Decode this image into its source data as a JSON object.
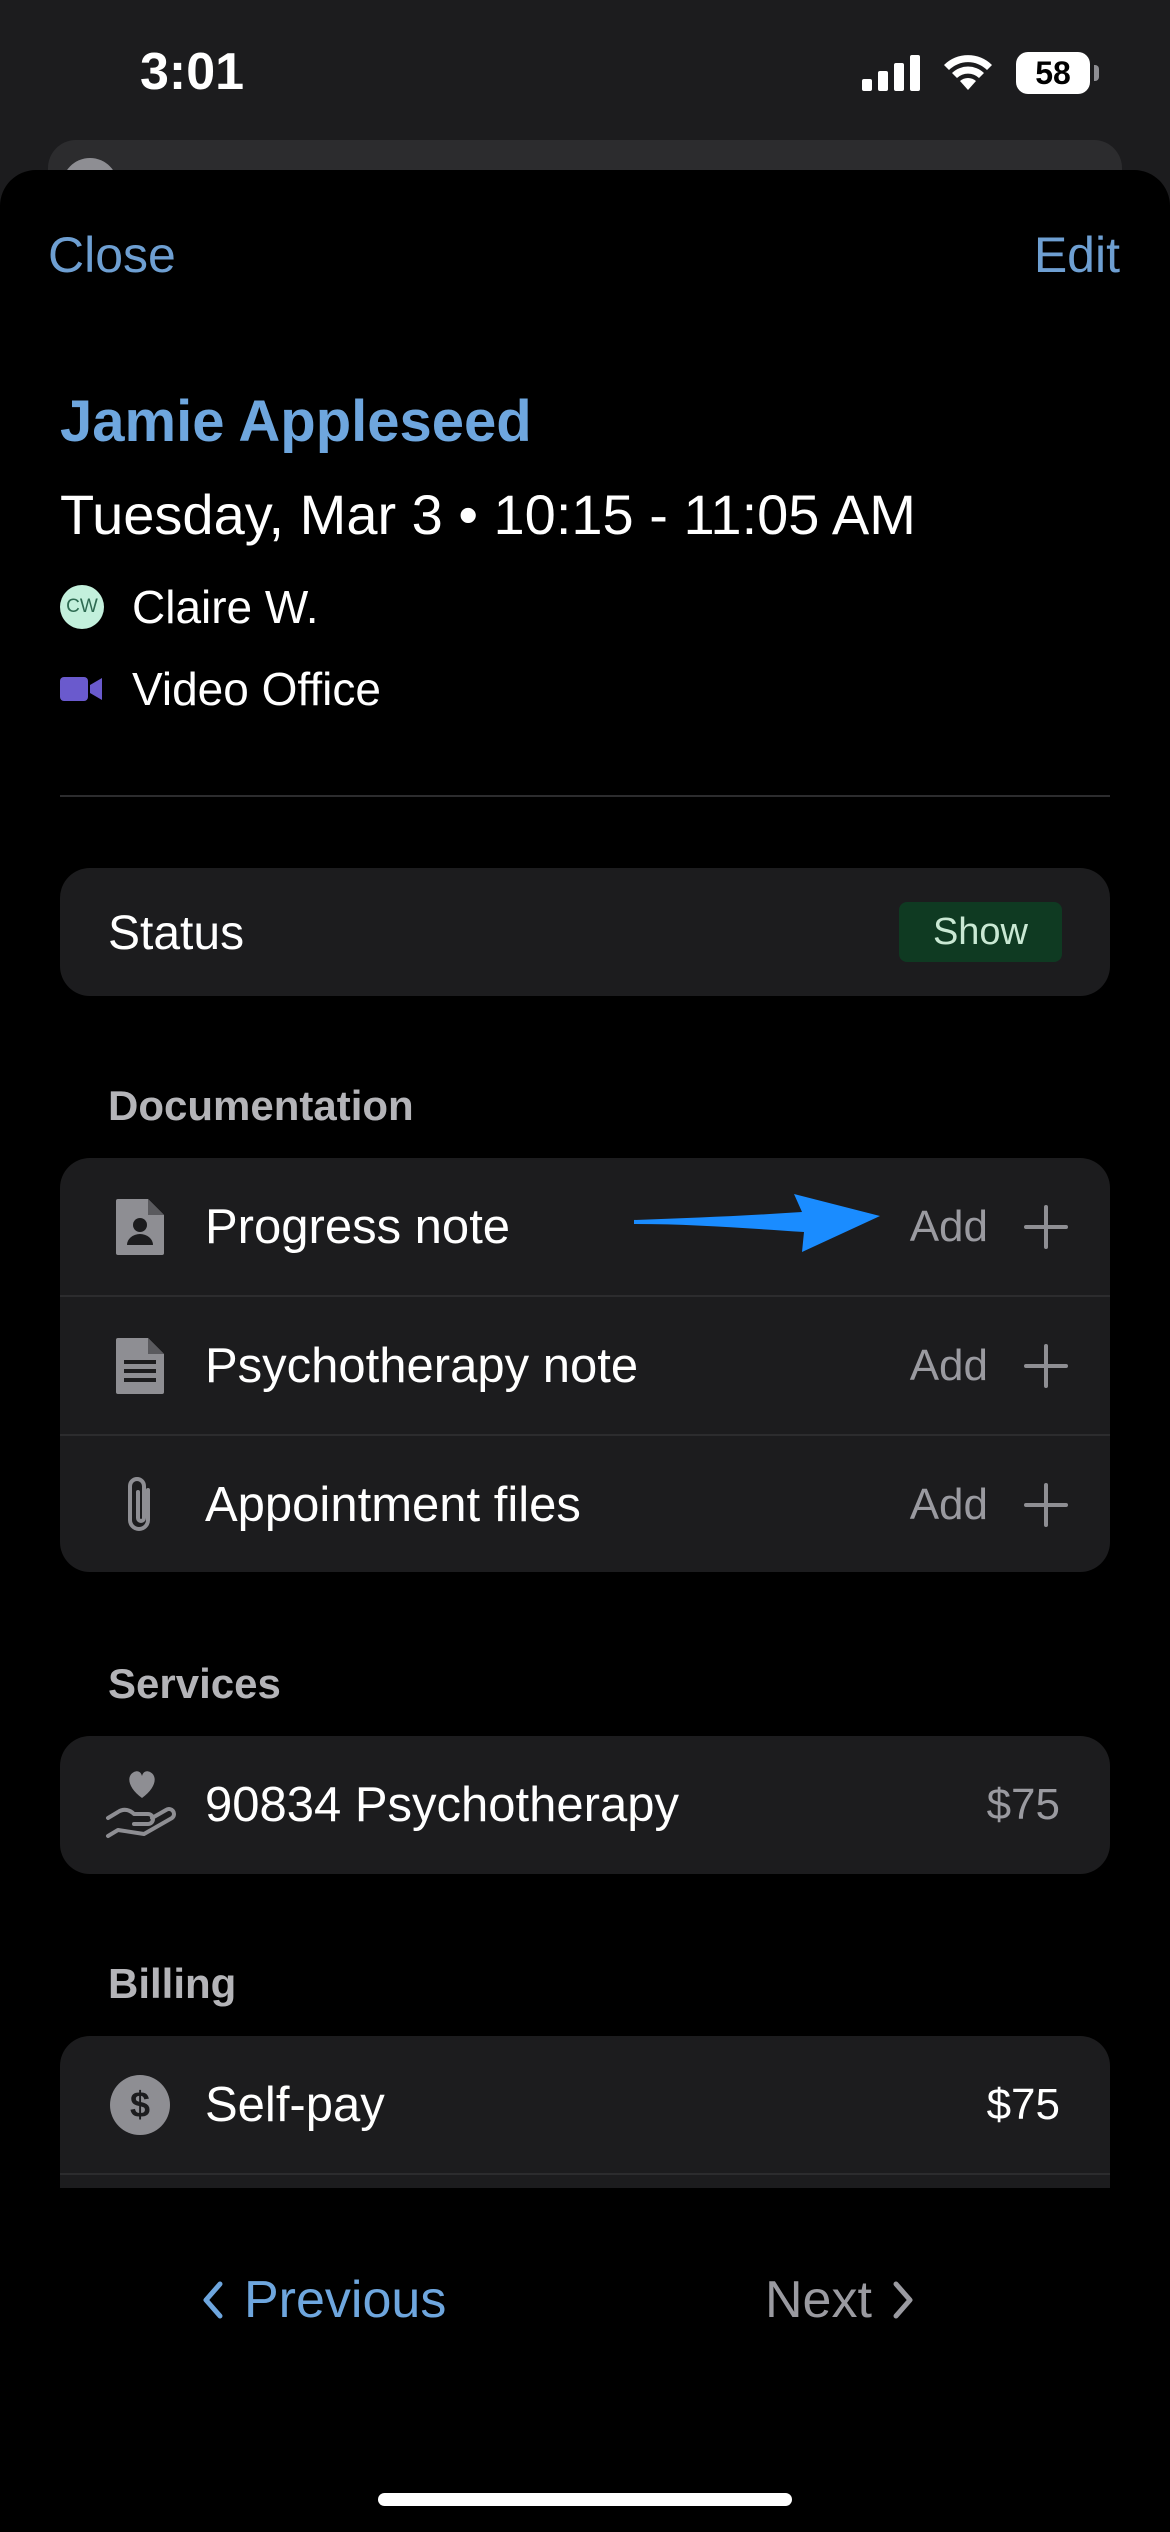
{
  "status_bar": {
    "time": "3:01",
    "battery": "58"
  },
  "header": {
    "close_label": "Close",
    "edit_label": "Edit"
  },
  "appointment": {
    "client_name": "Jamie Appleseed",
    "datetime": "Tuesday, Mar 3 • 10:15 - 11:05 AM",
    "clinician_initials": "CW",
    "clinician": "Claire W.",
    "location": "Video Office"
  },
  "status": {
    "label": "Status",
    "value": "Show"
  },
  "documentation": {
    "title": "Documentation",
    "items": [
      {
        "label": "Progress note",
        "action": "Add",
        "icon": "person-document-icon"
      },
      {
        "label": "Psychotherapy note",
        "action": "Add",
        "icon": "document-lines-icon"
      },
      {
        "label": "Appointment files",
        "action": "Add",
        "icon": "paperclip-icon"
      }
    ]
  },
  "services": {
    "title": "Services",
    "items": [
      {
        "label": "90834 Psychotherapy",
        "amount": "$75",
        "icon": "hand-heart-icon"
      }
    ]
  },
  "billing": {
    "title": "Billing",
    "items": [
      {
        "label": "Self-pay",
        "amount": "$75",
        "icon": "dollar-circle-icon"
      }
    ]
  },
  "footer": {
    "previous_label": "Previous",
    "next_label": "Next"
  },
  "colors": {
    "accent": "#6ea6de",
    "annotation_arrow": "#1a8cff",
    "background": "#000000",
    "card": "#1c1c1e"
  }
}
